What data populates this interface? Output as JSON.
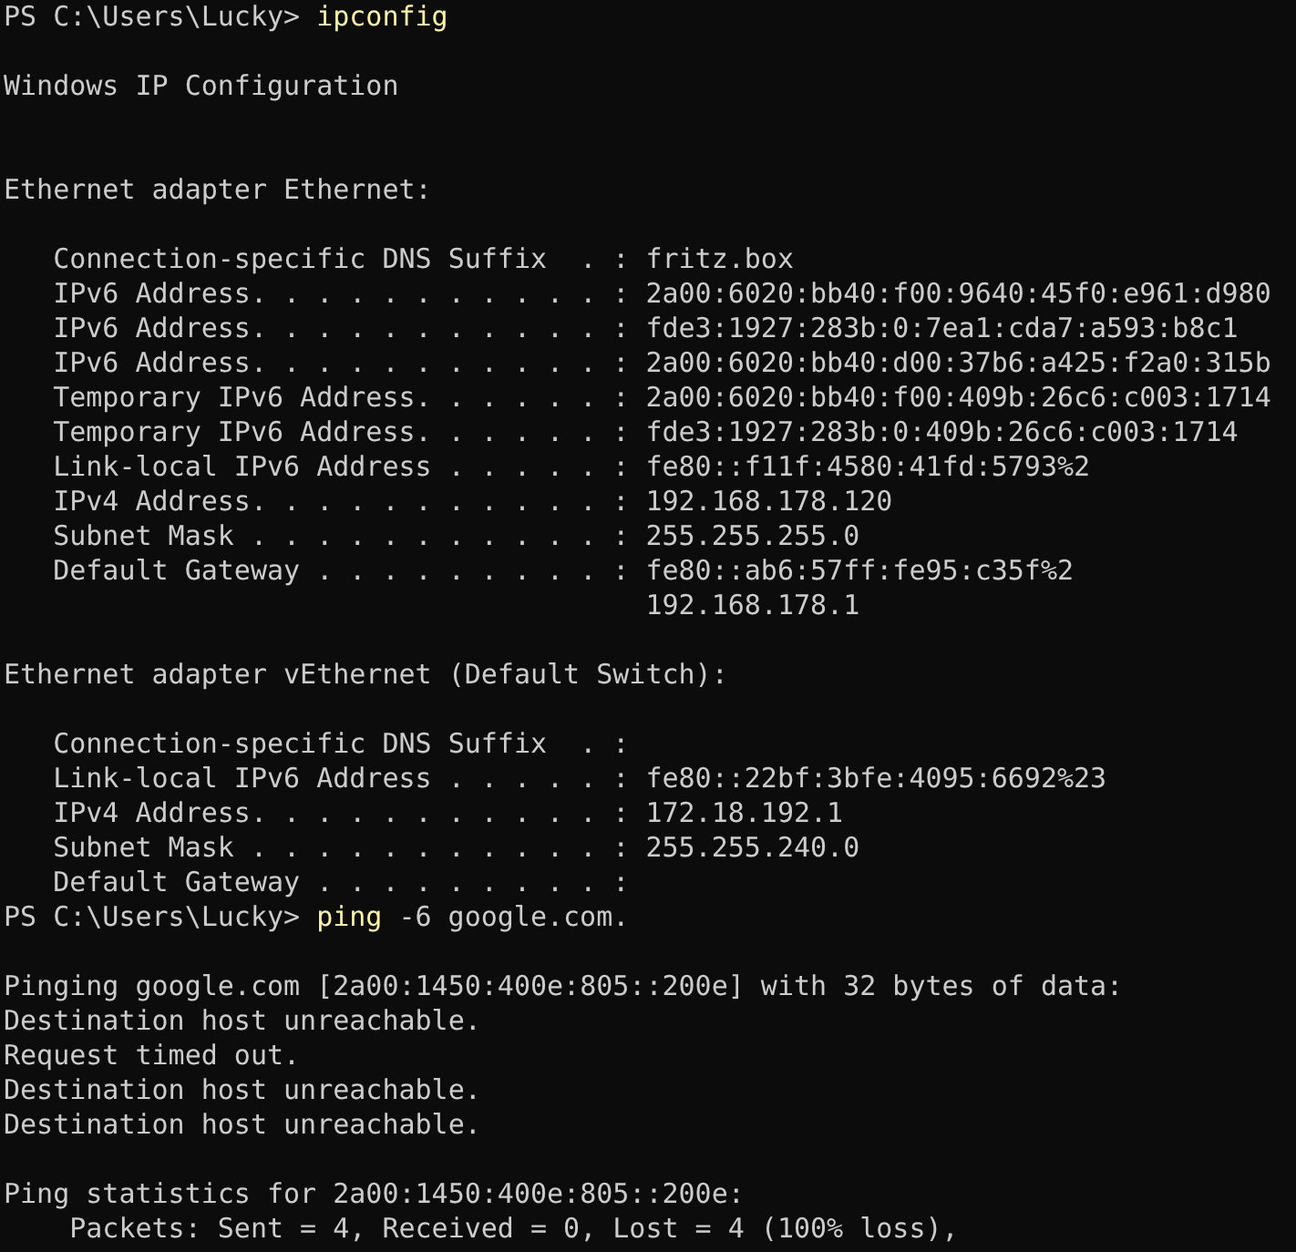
{
  "terminal": {
    "lines": [
      {
        "kind": "prompt",
        "prompt": "PS C:\\Users\\Lucky>",
        "command": "ipconfig"
      },
      {
        "kind": "blank"
      },
      {
        "kind": "output",
        "text": "Windows IP Configuration"
      },
      {
        "kind": "blank"
      },
      {
        "kind": "blank"
      },
      {
        "kind": "output",
        "text": "Ethernet adapter Ethernet:"
      },
      {
        "kind": "blank"
      },
      {
        "kind": "output",
        "text": "   Connection-specific DNS Suffix  . : fritz.box"
      },
      {
        "kind": "output",
        "text": "   IPv6 Address. . . . . . . . . . . : 2a00:6020:bb40:f00:9640:45f0:e961:d980"
      },
      {
        "kind": "output",
        "text": "   IPv6 Address. . . . . . . . . . . : fde3:1927:283b:0:7ea1:cda7:a593:b8c1"
      },
      {
        "kind": "output",
        "text": "   IPv6 Address. . . . . . . . . . . : 2a00:6020:bb40:d00:37b6:a425:f2a0:315b"
      },
      {
        "kind": "output",
        "text": "   Temporary IPv6 Address. . . . . . : 2a00:6020:bb40:f00:409b:26c6:c003:1714"
      },
      {
        "kind": "output",
        "text": "   Temporary IPv6 Address. . . . . . : fde3:1927:283b:0:409b:26c6:c003:1714"
      },
      {
        "kind": "output",
        "text": "   Link-local IPv6 Address . . . . . : fe80::f11f:4580:41fd:5793%2"
      },
      {
        "kind": "output",
        "text": "   IPv4 Address. . . . . . . . . . . : 192.168.178.120"
      },
      {
        "kind": "output",
        "text": "   Subnet Mask . . . . . . . . . . . : 255.255.255.0"
      },
      {
        "kind": "output",
        "text": "   Default Gateway . . . . . . . . . : fe80::ab6:57ff:fe95:c35f%2"
      },
      {
        "kind": "output",
        "text": "                                       192.168.178.1"
      },
      {
        "kind": "blank"
      },
      {
        "kind": "output",
        "text": "Ethernet adapter vEthernet (Default Switch):"
      },
      {
        "kind": "blank"
      },
      {
        "kind": "output",
        "text": "   Connection-specific DNS Suffix  . :"
      },
      {
        "kind": "output",
        "text": "   Link-local IPv6 Address . . . . . : fe80::22bf:3bfe:4095:6692%23"
      },
      {
        "kind": "output",
        "text": "   IPv4 Address. . . . . . . . . . . : 172.18.192.1"
      },
      {
        "kind": "output",
        "text": "   Subnet Mask . . . . . . . . . . . : 255.255.240.0"
      },
      {
        "kind": "output",
        "text": "   Default Gateway . . . . . . . . . :"
      },
      {
        "kind": "prompt",
        "prompt": "PS C:\\Users\\Lucky>",
        "command": "ping",
        "args": "-6 google.com."
      },
      {
        "kind": "blank"
      },
      {
        "kind": "output",
        "text": "Pinging google.com [2a00:1450:400e:805::200e] with 32 bytes of data:"
      },
      {
        "kind": "output",
        "text": "Destination host unreachable."
      },
      {
        "kind": "output",
        "text": "Request timed out."
      },
      {
        "kind": "output",
        "text": "Destination host unreachable."
      },
      {
        "kind": "output",
        "text": "Destination host unreachable."
      },
      {
        "kind": "blank"
      },
      {
        "kind": "output",
        "text": "Ping statistics for 2a00:1450:400e:805::200e:"
      },
      {
        "kind": "output",
        "text": "    Packets: Sent = 4, Received = 0, Lost = 4 (100% loss),"
      }
    ]
  }
}
